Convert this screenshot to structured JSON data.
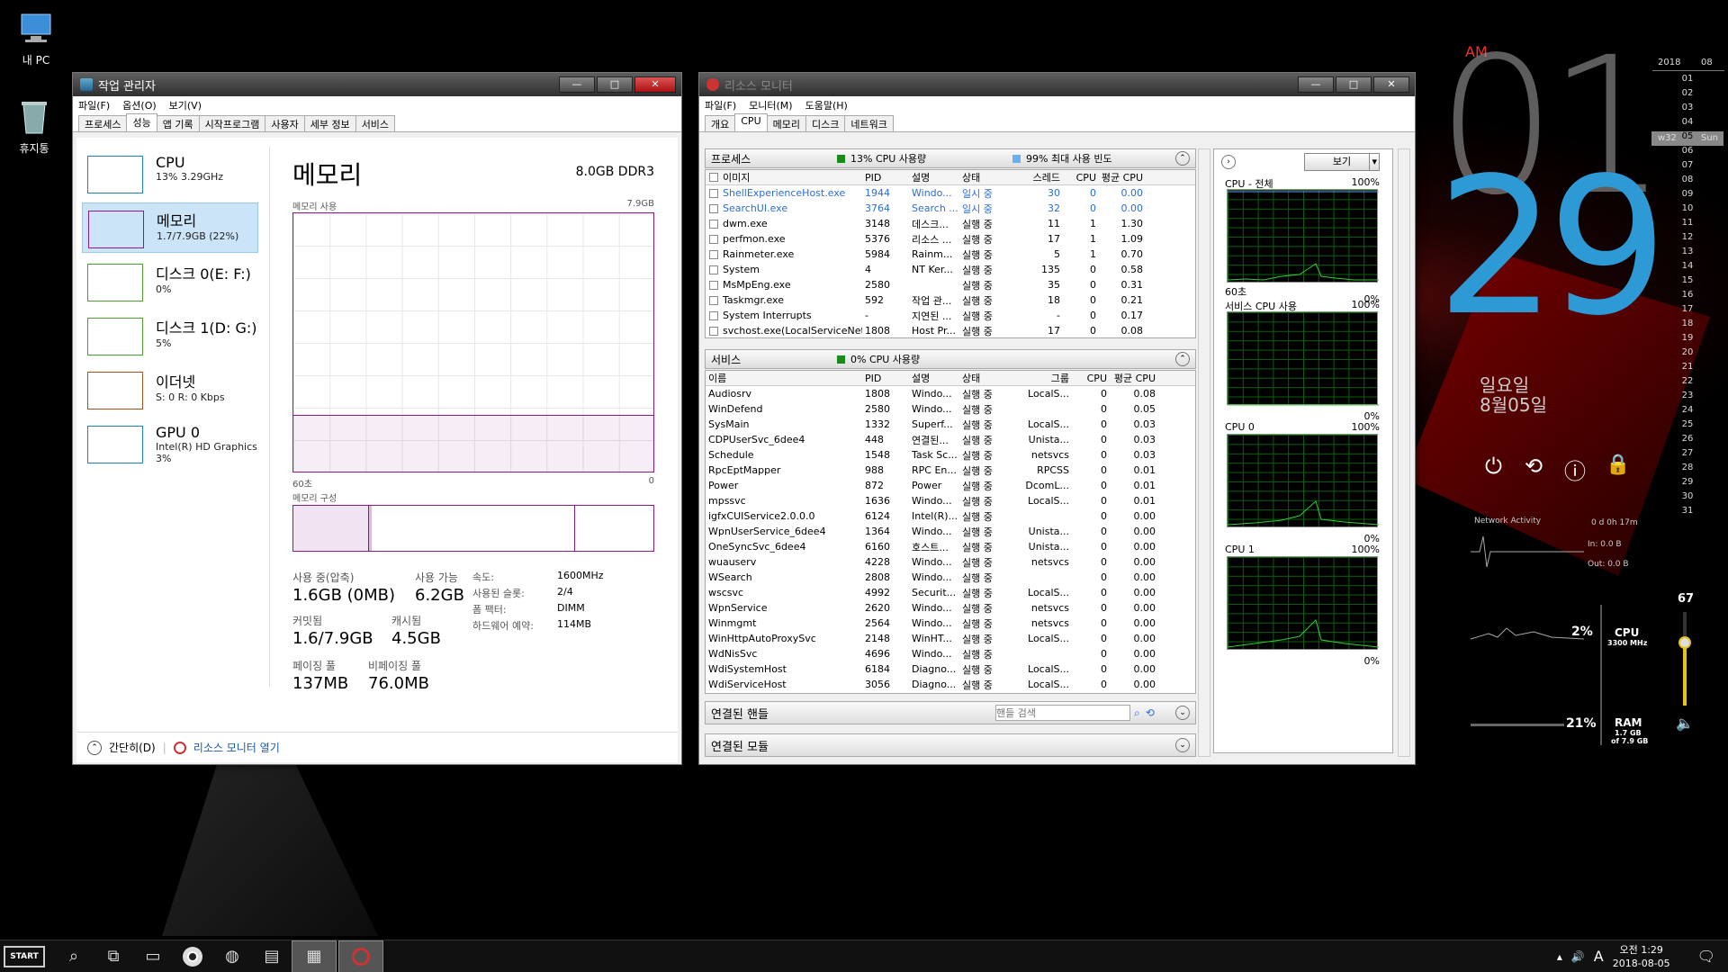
{
  "desktop": {
    "icons": [
      {
        "label": "내 PC",
        "icon": "computer-icon"
      },
      {
        "label": "휴지통",
        "icon": "recycle-bin-icon"
      }
    ]
  },
  "taskmgr": {
    "title": "작업 관리자",
    "menu": [
      "파일(F)",
      "옵션(O)",
      "보기(V)"
    ],
    "tabs": [
      "프로세스",
      "성능",
      "앱 기록",
      "시작프로그램",
      "사용자",
      "세부 정보",
      "서비스"
    ],
    "sidebar": [
      {
        "name": "CPU",
        "sub": "13% 3.29GHz",
        "color": "#1e80c8"
      },
      {
        "name": "메모리",
        "sub": "1.7/7.9GB (22%)",
        "color": "#8b1a8b"
      },
      {
        "name": "디스크 0(E: F:)",
        "sub": "0%",
        "color": "#4da032"
      },
      {
        "name": "디스크 1(D: G:)",
        "sub": "5%",
        "color": "#4da032"
      },
      {
        "name": "이더넷",
        "sub": "S: 0 R: 0 Kbps",
        "color": "#a7501e"
      },
      {
        "name": "GPU 0",
        "sub": "Intel(R) HD Graphics",
        "sub2": "3%",
        "color": "#1e80c8"
      }
    ],
    "title_main": "메모리",
    "mem_type": "8.0GB DDR3",
    "usage_label": "메모리 사용",
    "usage_max": "7.9GB",
    "usage_fraction": 0.22,
    "time_left": "60초",
    "time_right": "0",
    "composition_label": "메모리 구성",
    "stats": {
      "in_use_label": "사용 중(압축)",
      "in_use": "1.6GB (0MB)",
      "avail_label": "사용 가능",
      "avail": "6.2GB",
      "committed_label": "커밋됨",
      "committed": "1.6/7.9GB",
      "cached_label": "캐시됨",
      "cached": "4.5GB",
      "paged_label": "페이징 풀",
      "paged": "137MB",
      "nonpaged_label": "비페이징 풀",
      "nonpaged": "76.0MB",
      "speed_label": "속도:",
      "speed": "1600MHz",
      "slots_label": "사용된 슬롯:",
      "slots": "2/4",
      "form_label": "폼 팩터:",
      "form": "DIMM",
      "hwres_label": "하드웨어 예약:",
      "hwres": "114MB"
    },
    "footer": {
      "less": "간단히(D)",
      "open_rm": "리소스 모니터 열기"
    }
  },
  "resmon": {
    "title": "리소스 모니터",
    "menu": [
      "파일(F)",
      "모니터(M)",
      "도움말(H)"
    ],
    "tabs": [
      "개요",
      "CPU",
      "메모리",
      "디스크",
      "네트워크"
    ],
    "processes": {
      "label": "프로세스",
      "usage": "13% CPU 사용량",
      "maxfreq": "99% 최대 사용 빈도",
      "headers": [
        "이미지",
        "PID",
        "설명",
        "상태",
        "스레드",
        "CPU",
        "평균 CPU"
      ],
      "rows": [
        [
          "ShellExperienceHost.exe",
          "1944",
          "Windo...",
          "일시 중",
          "30",
          "0",
          "0.00"
        ],
        [
          "SearchUI.exe",
          "3764",
          "Search ...",
          "일시 중",
          "32",
          "0",
          "0.00"
        ],
        [
          "dwm.exe",
          "3148",
          "데스크...",
          "실행 중",
          "11",
          "1",
          "1.30"
        ],
        [
          "perfmon.exe",
          "5376",
          "리소스 ...",
          "실행 중",
          "17",
          "1",
          "1.09"
        ],
        [
          "Rainmeter.exe",
          "5984",
          "Rainm...",
          "실행 중",
          "5",
          "1",
          "0.70"
        ],
        [
          "System",
          "4",
          "NT Ker...",
          "실행 중",
          "135",
          "0",
          "0.58"
        ],
        [
          "MsMpEng.exe",
          "2580",
          "",
          "실행 중",
          "35",
          "0",
          "0.31"
        ],
        [
          "Taskmgr.exe",
          "592",
          "작업 관...",
          "실행 중",
          "18",
          "0",
          "0.21"
        ],
        [
          "System Interrupts",
          "-",
          "지연된 ...",
          "실행 중",
          "-",
          "0",
          "0.17"
        ],
        [
          "svchost.exe(LocalServiceNet...",
          "1808",
          "Host Pr...",
          "실행 중",
          "17",
          "0",
          "0.08"
        ]
      ]
    },
    "services": {
      "label": "서비스",
      "usage": "0% CPU 사용량",
      "headers": [
        "이름",
        "PID",
        "설명",
        "상태",
        "그룹",
        "CPU",
        "평균 CPU"
      ],
      "rows": [
        [
          "Audiosrv",
          "1808",
          "Windo...",
          "실행 중",
          "LocalS...",
          "0",
          "0.08"
        ],
        [
          "WinDefend",
          "2580",
          "Windo...",
          "실행 중",
          "",
          "0",
          "0.05"
        ],
        [
          "SysMain",
          "1332",
          "Superf...",
          "실행 중",
          "LocalS...",
          "0",
          "0.03"
        ],
        [
          "CDPUserSvc_6dee4",
          "448",
          "연결된...",
          "실행 중",
          "Unista...",
          "0",
          "0.03"
        ],
        [
          "Schedule",
          "1548",
          "Task Sc...",
          "실행 중",
          "netsvcs",
          "0",
          "0.03"
        ],
        [
          "RpcEptMapper",
          "988",
          "RPC En...",
          "실행 중",
          "RPCSS",
          "0",
          "0.01"
        ],
        [
          "Power",
          "872",
          "Power",
          "실행 중",
          "DcomL...",
          "0",
          "0.01"
        ],
        [
          "mpssvc",
          "1636",
          "Windo...",
          "실행 중",
          "LocalS...",
          "0",
          "0.01"
        ],
        [
          "igfxCUIService2.0.0.0",
          "6124",
          "Intel(R)...",
          "실행 중",
          "",
          "0",
          "0.00"
        ],
        [
          "WpnUserService_6dee4",
          "1364",
          "Windo...",
          "실행 중",
          "Unista...",
          "0",
          "0.00"
        ],
        [
          "OneSyncSvc_6dee4",
          "6160",
          "호스트...",
          "실행 중",
          "Unista...",
          "0",
          "0.00"
        ],
        [
          "wuauserv",
          "4228",
          "Windo...",
          "실행 중",
          "netsvcs",
          "0",
          "0.00"
        ],
        [
          "WSearch",
          "2808",
          "Windo...",
          "실행 중",
          "",
          "0",
          "0.00"
        ],
        [
          "wscsvc",
          "4992",
          "Securit...",
          "실행 중",
          "LocalS...",
          "0",
          "0.00"
        ],
        [
          "WpnService",
          "2620",
          "Windo...",
          "실행 중",
          "netsvcs",
          "0",
          "0.00"
        ],
        [
          "Winmgmt",
          "2564",
          "Windo...",
          "실행 중",
          "netsvcs",
          "0",
          "0.00"
        ],
        [
          "WinHttpAutoProxySvc",
          "2148",
          "WinHT...",
          "실행 중",
          "LocalS...",
          "0",
          "0.00"
        ],
        [
          "WdNisSvc",
          "4696",
          "Windo...",
          "실행 중",
          "",
          "0",
          "0.00"
        ],
        [
          "WdiSystemHost",
          "6184",
          "Diagno...",
          "실행 중",
          "LocalS...",
          "0",
          "0.00"
        ],
        [
          "WdiServiceHost",
          "3056",
          "Diagno...",
          "실행 중",
          "LocalS...",
          "0",
          "0.00"
        ]
      ]
    },
    "handles": {
      "label": "연결된 핸들",
      "search_placeholder": "핸들 검색"
    },
    "modules": {
      "label": "연결된 모듈"
    },
    "view_button": "보기",
    "graphs": [
      {
        "title": "CPU - 전체",
        "max": "100%",
        "foot_left": "60초",
        "foot_right": "0%"
      },
      {
        "title": "서비스 CPU 사용",
        "max": "100%",
        "foot_left": "",
        "foot_right": "0%"
      },
      {
        "title": "CPU 0",
        "max": "100%",
        "foot_left": "",
        "foot_right": "0%"
      },
      {
        "title": "CPU 1",
        "max": "100%",
        "foot_left": "",
        "foot_right": "0%"
      }
    ]
  },
  "clock": {
    "ampm": "AM",
    "hour": "01",
    "minute": "29",
    "weekday": "일요일",
    "date": "8월05일"
  },
  "calendar": {
    "year": "2018",
    "month": "08",
    "week": "w32",
    "today": "05",
    "today_name": "Sun",
    "days": [
      "01",
      "02",
      "03",
      "04",
      "05",
      "06",
      "07",
      "08",
      "09",
      "10",
      "11",
      "12",
      "13",
      "14",
      "15",
      "16",
      "17",
      "18",
      "19",
      "20",
      "21",
      "22",
      "23",
      "24",
      "25",
      "26",
      "27",
      "28",
      "29",
      "30",
      "31"
    ]
  },
  "net": {
    "label": "Network Activity",
    "uptime": "0 d 0h 17m",
    "in": "In: 0.0 B",
    "out": "Out: 0.0 B"
  },
  "sys": {
    "cpu_pct": "2%",
    "cpu_label": "CPU",
    "cpu_mhz": "3300 MHz",
    "ram_pct": "21%",
    "ram_label": "RAM",
    "ram_detail1": "1.7 GB",
    "ram_detail2": "of 7.9 GB",
    "volume": "67"
  },
  "tray": {
    "time": "오전 1:29",
    "date": "2018-08-05",
    "ime": "A"
  },
  "taskbar": {
    "start": "START"
  }
}
